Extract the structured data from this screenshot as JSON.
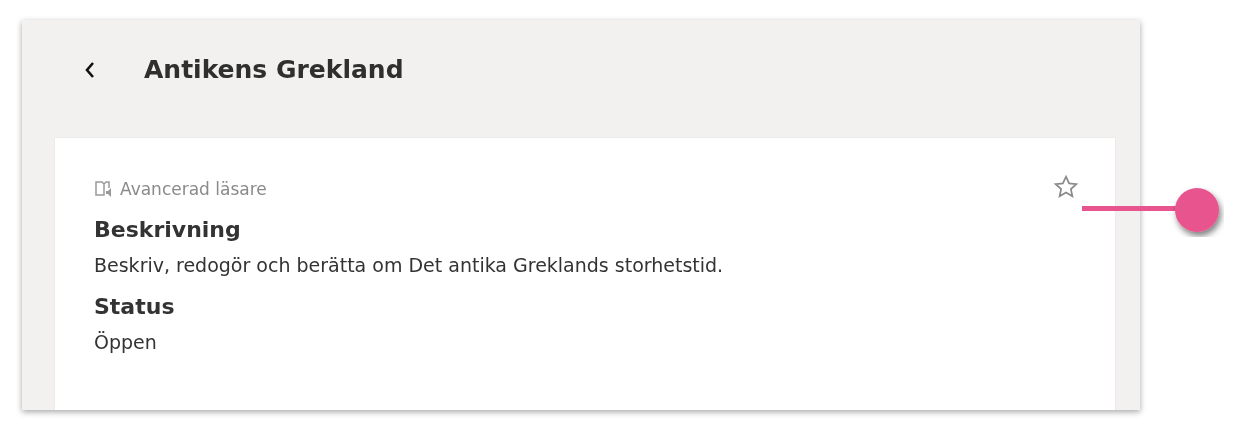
{
  "header": {
    "title": "Antikens Grekland"
  },
  "card": {
    "reader_label": "Avancerad läsare",
    "starred": false,
    "sections": [
      {
        "heading": "Beskrivning",
        "text": "Beskriv, redogör och berätta om Det antika Greklands storhetstid."
      },
      {
        "heading": "Status",
        "text": "Öppen"
      }
    ]
  }
}
